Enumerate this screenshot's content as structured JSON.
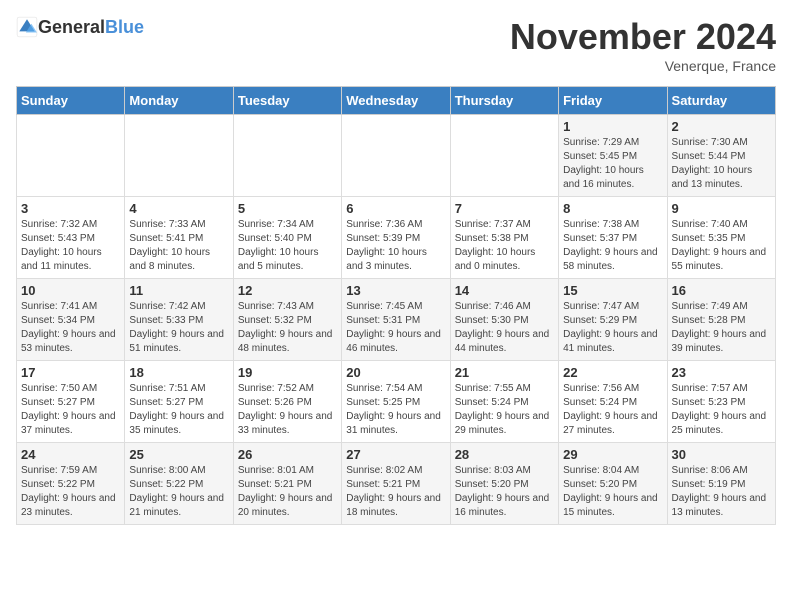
{
  "logo": {
    "text_general": "General",
    "text_blue": "Blue"
  },
  "header": {
    "month": "November 2024",
    "location": "Venerque, France"
  },
  "days_of_week": [
    "Sunday",
    "Monday",
    "Tuesday",
    "Wednesday",
    "Thursday",
    "Friday",
    "Saturday"
  ],
  "weeks": [
    [
      {
        "day": "",
        "info": ""
      },
      {
        "day": "",
        "info": ""
      },
      {
        "day": "",
        "info": ""
      },
      {
        "day": "",
        "info": ""
      },
      {
        "day": "",
        "info": ""
      },
      {
        "day": "1",
        "info": "Sunrise: 7:29 AM\nSunset: 5:45 PM\nDaylight: 10 hours and 16 minutes."
      },
      {
        "day": "2",
        "info": "Sunrise: 7:30 AM\nSunset: 5:44 PM\nDaylight: 10 hours and 13 minutes."
      }
    ],
    [
      {
        "day": "3",
        "info": "Sunrise: 7:32 AM\nSunset: 5:43 PM\nDaylight: 10 hours and 11 minutes."
      },
      {
        "day": "4",
        "info": "Sunrise: 7:33 AM\nSunset: 5:41 PM\nDaylight: 10 hours and 8 minutes."
      },
      {
        "day": "5",
        "info": "Sunrise: 7:34 AM\nSunset: 5:40 PM\nDaylight: 10 hours and 5 minutes."
      },
      {
        "day": "6",
        "info": "Sunrise: 7:36 AM\nSunset: 5:39 PM\nDaylight: 10 hours and 3 minutes."
      },
      {
        "day": "7",
        "info": "Sunrise: 7:37 AM\nSunset: 5:38 PM\nDaylight: 10 hours and 0 minutes."
      },
      {
        "day": "8",
        "info": "Sunrise: 7:38 AM\nSunset: 5:37 PM\nDaylight: 9 hours and 58 minutes."
      },
      {
        "day": "9",
        "info": "Sunrise: 7:40 AM\nSunset: 5:35 PM\nDaylight: 9 hours and 55 minutes."
      }
    ],
    [
      {
        "day": "10",
        "info": "Sunrise: 7:41 AM\nSunset: 5:34 PM\nDaylight: 9 hours and 53 minutes."
      },
      {
        "day": "11",
        "info": "Sunrise: 7:42 AM\nSunset: 5:33 PM\nDaylight: 9 hours and 51 minutes."
      },
      {
        "day": "12",
        "info": "Sunrise: 7:43 AM\nSunset: 5:32 PM\nDaylight: 9 hours and 48 minutes."
      },
      {
        "day": "13",
        "info": "Sunrise: 7:45 AM\nSunset: 5:31 PM\nDaylight: 9 hours and 46 minutes."
      },
      {
        "day": "14",
        "info": "Sunrise: 7:46 AM\nSunset: 5:30 PM\nDaylight: 9 hours and 44 minutes."
      },
      {
        "day": "15",
        "info": "Sunrise: 7:47 AM\nSunset: 5:29 PM\nDaylight: 9 hours and 41 minutes."
      },
      {
        "day": "16",
        "info": "Sunrise: 7:49 AM\nSunset: 5:28 PM\nDaylight: 9 hours and 39 minutes."
      }
    ],
    [
      {
        "day": "17",
        "info": "Sunrise: 7:50 AM\nSunset: 5:27 PM\nDaylight: 9 hours and 37 minutes."
      },
      {
        "day": "18",
        "info": "Sunrise: 7:51 AM\nSunset: 5:27 PM\nDaylight: 9 hours and 35 minutes."
      },
      {
        "day": "19",
        "info": "Sunrise: 7:52 AM\nSunset: 5:26 PM\nDaylight: 9 hours and 33 minutes."
      },
      {
        "day": "20",
        "info": "Sunrise: 7:54 AM\nSunset: 5:25 PM\nDaylight: 9 hours and 31 minutes."
      },
      {
        "day": "21",
        "info": "Sunrise: 7:55 AM\nSunset: 5:24 PM\nDaylight: 9 hours and 29 minutes."
      },
      {
        "day": "22",
        "info": "Sunrise: 7:56 AM\nSunset: 5:24 PM\nDaylight: 9 hours and 27 minutes."
      },
      {
        "day": "23",
        "info": "Sunrise: 7:57 AM\nSunset: 5:23 PM\nDaylight: 9 hours and 25 minutes."
      }
    ],
    [
      {
        "day": "24",
        "info": "Sunrise: 7:59 AM\nSunset: 5:22 PM\nDaylight: 9 hours and 23 minutes."
      },
      {
        "day": "25",
        "info": "Sunrise: 8:00 AM\nSunset: 5:22 PM\nDaylight: 9 hours and 21 minutes."
      },
      {
        "day": "26",
        "info": "Sunrise: 8:01 AM\nSunset: 5:21 PM\nDaylight: 9 hours and 20 minutes."
      },
      {
        "day": "27",
        "info": "Sunrise: 8:02 AM\nSunset: 5:21 PM\nDaylight: 9 hours and 18 minutes."
      },
      {
        "day": "28",
        "info": "Sunrise: 8:03 AM\nSunset: 5:20 PM\nDaylight: 9 hours and 16 minutes."
      },
      {
        "day": "29",
        "info": "Sunrise: 8:04 AM\nSunset: 5:20 PM\nDaylight: 9 hours and 15 minutes."
      },
      {
        "day": "30",
        "info": "Sunrise: 8:06 AM\nSunset: 5:19 PM\nDaylight: 9 hours and 13 minutes."
      }
    ]
  ]
}
